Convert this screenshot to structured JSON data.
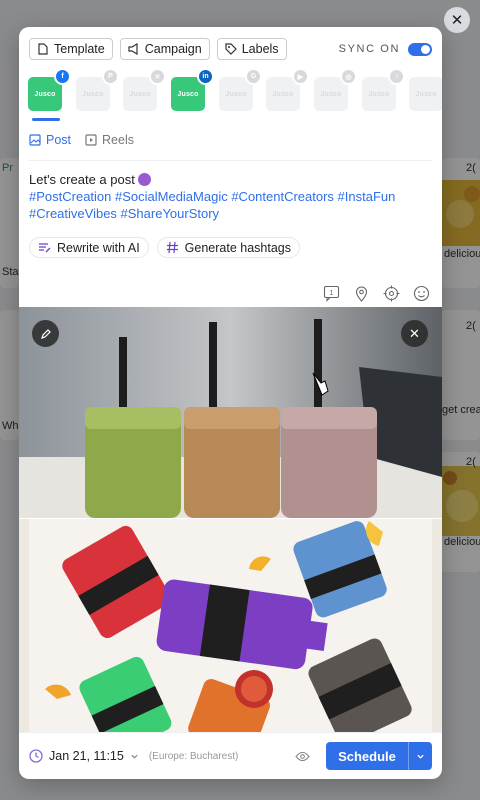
{
  "background": {
    "partial_texts": [
      "Sta",
      "Wh",
      "delicious",
      "get creat",
      "delicious",
      "Pr",
      "2(",
      "2(",
      "2("
    ]
  },
  "toolbar": {
    "template_label": "Template",
    "campaign_label": "Campaign",
    "labels_label": "Labels",
    "sync_label": "SYNC ON"
  },
  "accounts": [
    {
      "logo": "Jusco",
      "network": "facebook",
      "active": true
    },
    {
      "logo": "Jusco",
      "network": "pinterest",
      "active": false
    },
    {
      "logo": "Jusco",
      "network": "x",
      "active": false
    },
    {
      "logo": "Jusco",
      "network": "linkedin",
      "active": true
    },
    {
      "logo": "Jusco",
      "network": "google",
      "active": false
    },
    {
      "logo": "Jusco",
      "network": "youtube",
      "active": false
    },
    {
      "logo": "Jusco",
      "network": "instagram",
      "active": false
    },
    {
      "logo": "Jusco",
      "network": "tiktok",
      "active": false
    },
    {
      "logo": "Jusco",
      "network": "other",
      "active": false
    }
  ],
  "tabs": [
    {
      "label": "Post",
      "active": true
    },
    {
      "label": "Reels",
      "active": false
    }
  ],
  "post": {
    "text": "Let's create a post",
    "hashtags": "#PostCreation #SocialMediaMagic #ContentCreators #InstaFun #CreativeVibes #ShareYourStory"
  },
  "ai_actions": {
    "rewrite_label": "Rewrite with AI",
    "hashtags_label": "Generate hashtags"
  },
  "footer": {
    "date": "Jan 21, 11:15",
    "timezone": "(Europe: Bucharest)",
    "schedule_label": "Schedule"
  },
  "colors": {
    "accent": "#2f6fe8",
    "account_active": "#38c87a"
  }
}
